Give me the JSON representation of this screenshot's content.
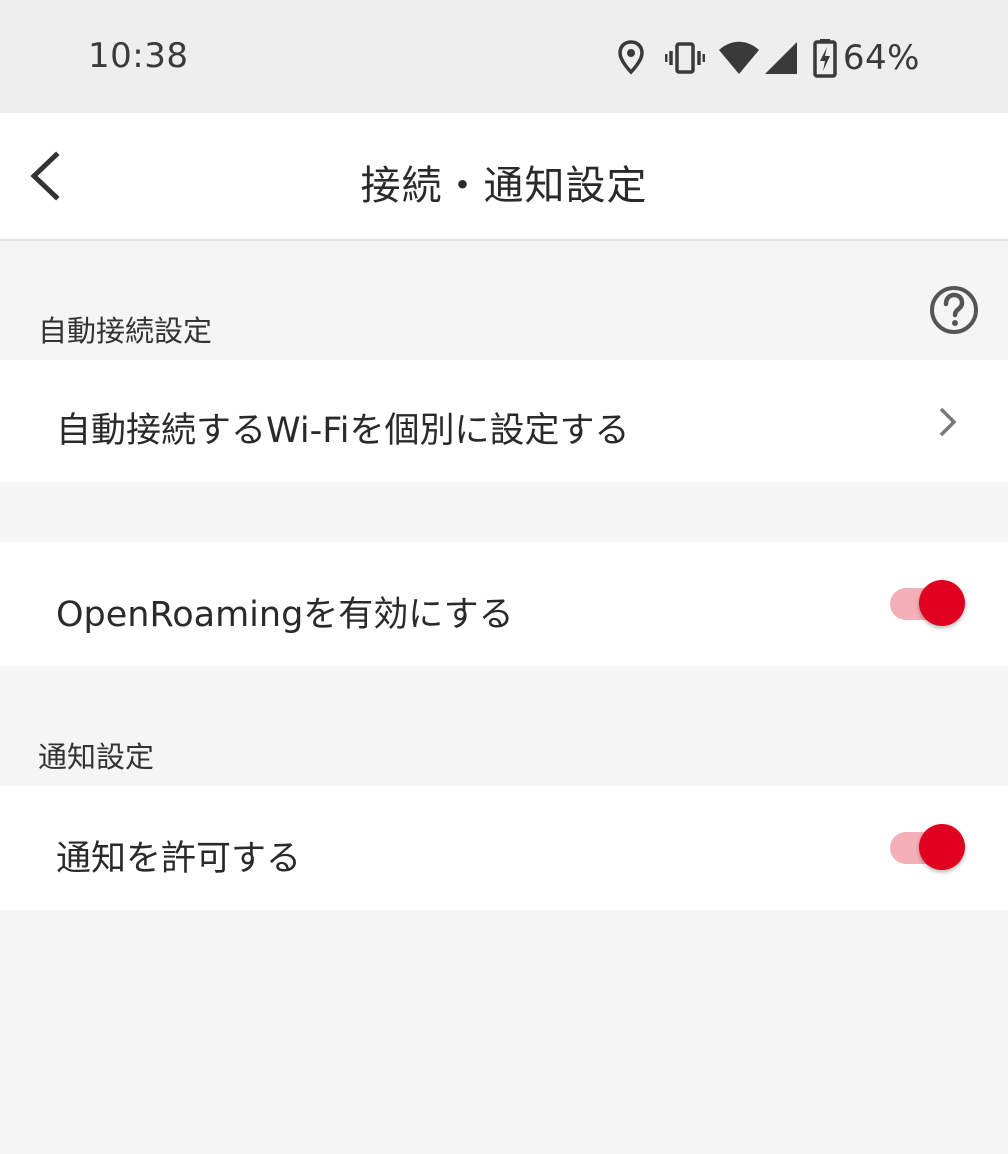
{
  "status_bar": {
    "time": "10:38",
    "battery_percent": "64%",
    "icons": [
      "location-icon",
      "vibrate-icon",
      "wifi-icon",
      "cell-signal-icon",
      "battery-charging-icon"
    ]
  },
  "app_bar": {
    "title": "接続・通知設定",
    "back_icon": "back-arrow-icon"
  },
  "sections": {
    "auto_connect": {
      "header": "自動接続設定",
      "help_icon": "help-circle-icon",
      "wifi_item_label": "自動接続するWi-Fiを個別に設定する",
      "wifi_item_icon": "chevron-right-icon"
    },
    "openroaming": {
      "label": "OpenRoamingを有効にする",
      "enabled": true
    },
    "notifications": {
      "header": "通知設定",
      "allow_label": "通知を許可する",
      "enabled": true
    }
  },
  "colors": {
    "accent": "#e0001f",
    "toggle_track": "#f4b0b8",
    "background": "#f5f5f5",
    "surface": "#ffffff",
    "status_bar": "#eeeeee"
  }
}
